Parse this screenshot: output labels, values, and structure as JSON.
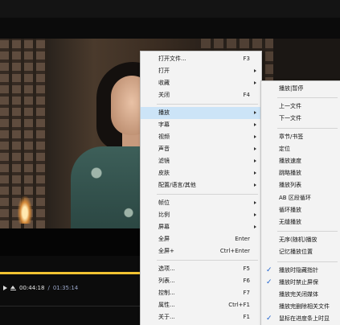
{
  "player": {
    "elapsed": "00:44:18",
    "separator": "/",
    "duration": "01:35:14",
    "progress_fraction": 0.46,
    "accent_color": "#f1c232"
  },
  "main_menu": {
    "items": [
      {
        "label": "打开文件...",
        "shortcut": "F3",
        "submenu": false
      },
      {
        "label": "打开",
        "shortcut": "",
        "submenu": true
      },
      {
        "label": "收藏",
        "shortcut": "",
        "submenu": true
      },
      {
        "label": "关闭",
        "shortcut": "F4",
        "submenu": false
      },
      {
        "label": "播放",
        "shortcut": "",
        "submenu": true,
        "active": true
      },
      {
        "label": "字幕",
        "shortcut": "",
        "submenu": true
      },
      {
        "label": "视频",
        "shortcut": "",
        "submenu": true
      },
      {
        "label": "声音",
        "shortcut": "",
        "submenu": true
      },
      {
        "label": "滤镜",
        "shortcut": "",
        "submenu": true
      },
      {
        "label": "皮肤",
        "shortcut": "",
        "submenu": true
      },
      {
        "label": "配置/语言/其他",
        "shortcut": "",
        "submenu": true
      },
      {
        "label": "帧位",
        "shortcut": "",
        "submenu": true
      },
      {
        "label": "比例",
        "shortcut": "",
        "submenu": true
      },
      {
        "label": "屏幕",
        "shortcut": "",
        "submenu": true
      },
      {
        "label": "全屏",
        "shortcut": "Enter",
        "submenu": false
      },
      {
        "label": "全屏+",
        "shortcut": "Ctrl+Enter",
        "submenu": false
      },
      {
        "label": "选项...",
        "shortcut": "F5",
        "submenu": false
      },
      {
        "label": "列表...",
        "shortcut": "F6",
        "submenu": false
      },
      {
        "label": "控制...",
        "shortcut": "F7",
        "submenu": false
      },
      {
        "label": "属性...",
        "shortcut": "Ctrl+F1",
        "submenu": false
      },
      {
        "label": "关于...",
        "shortcut": "F1",
        "submenu": false
      }
    ]
  },
  "playback_menu": {
    "items": [
      {
        "label": "播放|暂停",
        "checked": false
      },
      {
        "label": "上一文件",
        "checked": false
      },
      {
        "label": "下一文件",
        "checked": false
      },
      {
        "label": "章节/书签",
        "checked": false
      },
      {
        "label": "定位",
        "checked": false
      },
      {
        "label": "播放速度",
        "checked": false
      },
      {
        "label": "跳略播放",
        "checked": false
      },
      {
        "label": "播放列表",
        "checked": false
      },
      {
        "label": "AB 区段循环",
        "checked": false
      },
      {
        "label": "循环播放",
        "checked": false
      },
      {
        "label": "无缝播放",
        "checked": false
      },
      {
        "label": "无序(随机)播放",
        "checked": false
      },
      {
        "label": "记忆播放位置",
        "checked": false
      },
      {
        "label": "播放时隐藏指针",
        "checked": true
      },
      {
        "label": "播放时禁止屏保",
        "checked": true
      },
      {
        "label": "播放完关闭媒体",
        "checked": false
      },
      {
        "label": "播放完删除相关文件",
        "checked": false
      },
      {
        "label": "鼠标在进度条上时显",
        "checked": true
      }
    ],
    "check_glyph": "✓"
  }
}
